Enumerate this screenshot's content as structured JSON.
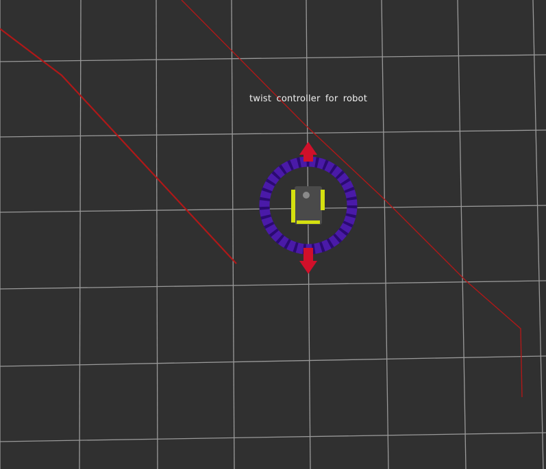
{
  "scene": {
    "marker_text": "twist controller for robot",
    "colors": {
      "background": "#303030",
      "grid": "#9a9a9a",
      "laser_line": "#b01818",
      "ring": "#4a1aa8",
      "ring_stripe": "#2a0a70",
      "arrow": "#d0102a",
      "robot_body": "#4a4a4a",
      "robot_wheels": "#d4e010"
    },
    "icons": {
      "rotation_ring": "rotation-ring-icon",
      "forward_arrow": "arrow-up-icon",
      "backward_arrow": "arrow-down-icon",
      "robot": "robot-icon"
    }
  }
}
